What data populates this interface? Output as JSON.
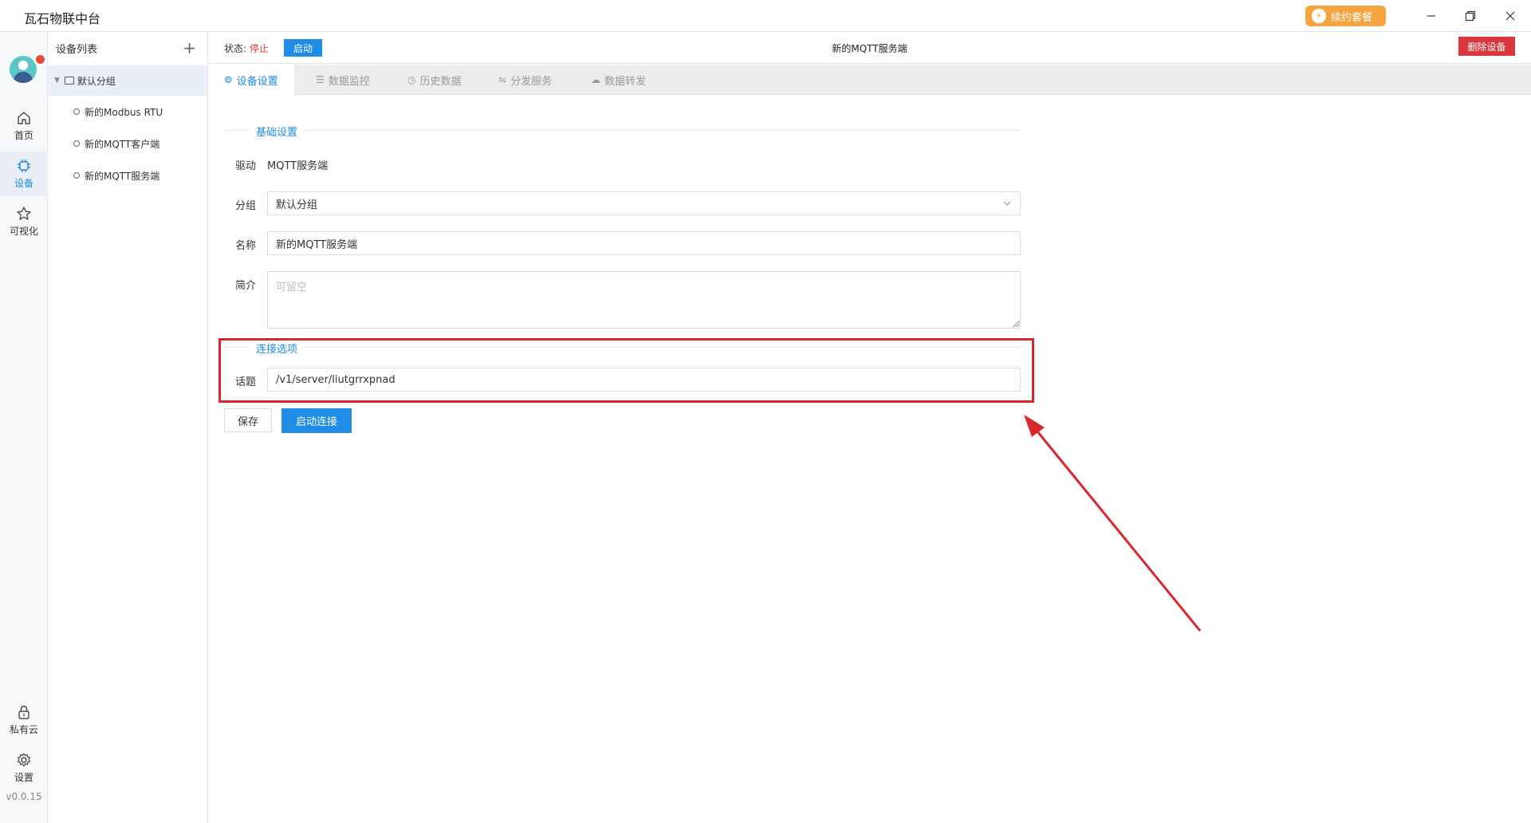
{
  "titlebar": {
    "app_title": "瓦石物联中台",
    "renew_label": "续约套餐",
    "minimize_icon": "minimize-icon",
    "maximize_icon": "restore-icon",
    "close_icon": "close-icon"
  },
  "leftnav": {
    "items": [
      {
        "label": "首页",
        "icon": "home-icon"
      },
      {
        "label": "设备",
        "icon": "chip-icon"
      },
      {
        "label": "可视化",
        "icon": "star-icon"
      },
      {
        "label": "私有云",
        "icon": "lock-icon"
      },
      {
        "label": "设置",
        "icon": "gear-icon"
      }
    ],
    "version": "v0.0.15"
  },
  "device_panel": {
    "title": "设备列表",
    "add_symbol": "+",
    "group": "默认分组",
    "devices": [
      "新的Modbus RTU",
      "新的MQTT客户端",
      "新的MQTT服务端"
    ]
  },
  "status": {
    "label": "状态:",
    "value": "停止",
    "start_label": "启动",
    "device_title": "新的MQTT服务端",
    "delete_label": "删除设备"
  },
  "tabs": [
    {
      "label": "设备设置",
      "icon": "settings-icon",
      "active": true
    },
    {
      "label": "数据监控",
      "icon": "database-icon"
    },
    {
      "label": "历史数据",
      "icon": "clock-icon"
    },
    {
      "label": "分发服务",
      "icon": "share-icon"
    },
    {
      "label": "数据转发",
      "icon": "cloud-icon"
    }
  ],
  "form": {
    "basic_section": "基础设置",
    "driver_label": "驱动",
    "driver_value": "MQTT服务端",
    "group_label": "分组",
    "group_value": "默认分组",
    "name_label": "名称",
    "name_value": "新的MQTT服务端",
    "desc_label": "简介",
    "desc_placeholder": "可留空",
    "conn_section": "连接选项",
    "topic_label": "话题",
    "topic_value": "/v1/server/liutgrrxpnad",
    "save_label": "保存",
    "connect_label": "启动连接"
  },
  "colors": {
    "accent": "#1f8ce6",
    "danger": "#d9363e",
    "renew": "#f5a440",
    "annotation": "#d9272e"
  }
}
